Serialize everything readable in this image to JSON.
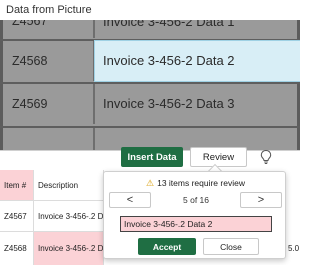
{
  "window": {
    "title": "Data from Picture"
  },
  "capture": {
    "rows": [
      {
        "id": "Z4567",
        "desc": "Invoice 3-456-2 Data 1"
      },
      {
        "id": "Z4568",
        "desc": "Invoice 3-456-2 Data 2"
      },
      {
        "id": "Z4569",
        "desc": "Invoice 3-456-2 Data 3"
      }
    ]
  },
  "grid": {
    "headers": {
      "item": "Item #",
      "description": "Description"
    },
    "rows": [
      {
        "item": "Z4567",
        "description": "Invoice 3-456-.2 Data 1"
      },
      {
        "item": "Z4568",
        "description": "Invoice 3-456-.2 Data 2",
        "extra": "5.0"
      }
    ]
  },
  "toolbar": {
    "insert_label": "Insert Data",
    "review_label": "Review",
    "bulb_icon": "lightbulb-icon"
  },
  "review_popup": {
    "warning_icon": "warning-icon",
    "warning_text": "13 items require review",
    "prev_glyph": "<",
    "next_glyph": ">",
    "position_text": "5 of 16",
    "edit_value": "Invoice 3-456-.2 Data 2",
    "accept_label": "Accept",
    "close_label": "Close"
  },
  "colors": {
    "accent": "#1f6e43",
    "needs_review": "#fbd2d6",
    "selection": "#d8eef6"
  }
}
